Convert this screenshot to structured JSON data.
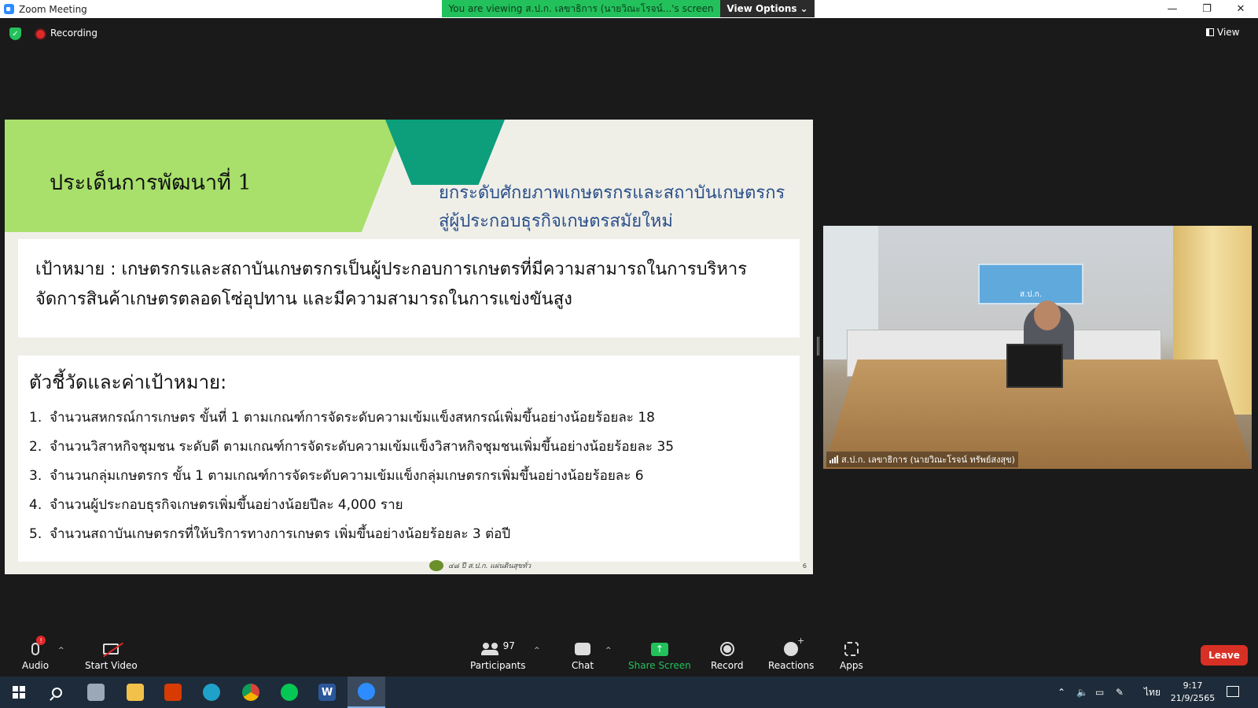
{
  "window": {
    "title": "Zoom Meeting",
    "viewing_banner": "You are viewing ส.ป.ก. เลขาธิการ (นายวิณะโรจน์...'s screen",
    "view_options": "View Options",
    "controls": [
      "—",
      "❐",
      "✕"
    ]
  },
  "status": {
    "recording_label": "Recording",
    "view_label": "View"
  },
  "slide": {
    "title": "ประเด็นการพัฒนาที่ 1",
    "subtitle_line1": "ยกระดับศักยภาพเกษตรกรและสถาบันเกษตรกร",
    "subtitle_line2": "สู่ผู้ประกอบธุรกิจเกษตรสมัยใหม่",
    "goal_line1": "เป้าหมาย : เกษตรกรและสถาบันเกษตรกรเป็นผู้ประกอบการเกษตรที่มีความสามารถในการบริหาร",
    "goal_line2": "จัดการสินค้าเกษตรตลอดโซ่อุปทาน และมีความสามารถในการแข่งขันสูง",
    "kpi_heading": "ตัวชี้วัดและค่าเป้าหมาย:",
    "kpis": [
      {
        "num": "1.",
        "text": "จำนวนสหกรณ์การเกษตร ขั้นที่ 1 ตามเกณฑ์การจัดระดับความเข้มแข็งสหกรณ์เพิ่มขึ้นอย่างน้อยร้อยละ 18"
      },
      {
        "num": "2.",
        "text": "จำนวนวิสาหกิจชุมชน ระดับดี ตามเกณฑ์การจัดระดับความเข้มแข็งวิสาหกิจชุมชนเพิ่มขึ้นอย่างน้อยร้อยละ 35"
      },
      {
        "num": "3.",
        "text": "จำนวนกลุ่มเกษตรกร ขั้น 1 ตามเกณฑ์การจัดระดับความเข้มแข็งกลุ่มเกษตรกรเพิ่มขึ้นอย่างน้อยร้อยละ 6"
      },
      {
        "num": "4.",
        "text": "จำนวนผู้ประกอบธุรกิจเกษตรเพิ่มขึ้นอย่างน้อยปีละ 4,000 ราย"
      },
      {
        "num": "5.",
        "text": "จำนวนสถาบันเกษตรกรที่ให้บริการทางการเกษตร เพิ่มขึ้นอย่างน้อยร้อยละ 3 ต่อปี"
      }
    ],
    "footer_text": "๔๘ ปี ส.ป.ก. แผ่นดินสุขทั่ว",
    "page_number": "6"
  },
  "video": {
    "participant_name": "ส.ป.ก. เลขาธิการ (นายวิณะโรจน์ ทรัพย์สงสุข)",
    "banner_text": "ส.ป.ก."
  },
  "toolbar": {
    "audio": "Audio",
    "audio_badge": "!",
    "start_video": "Start Video",
    "participants": "Participants",
    "participant_count": "97",
    "chat": "Chat",
    "share_screen": "Share Screen",
    "record": "Record",
    "reactions": "Reactions",
    "apps": "Apps",
    "leave": "Leave"
  },
  "taskbar": {
    "language": "ไทย",
    "time": "9:17",
    "date": "21/9/2565"
  },
  "colors": {
    "share_green": "#23c15b",
    "leave_red": "#d93025",
    "slide_green": "#a8e06b",
    "slide_teal": "#0d9e7c",
    "subtitle_blue": "#2b4f8a"
  }
}
